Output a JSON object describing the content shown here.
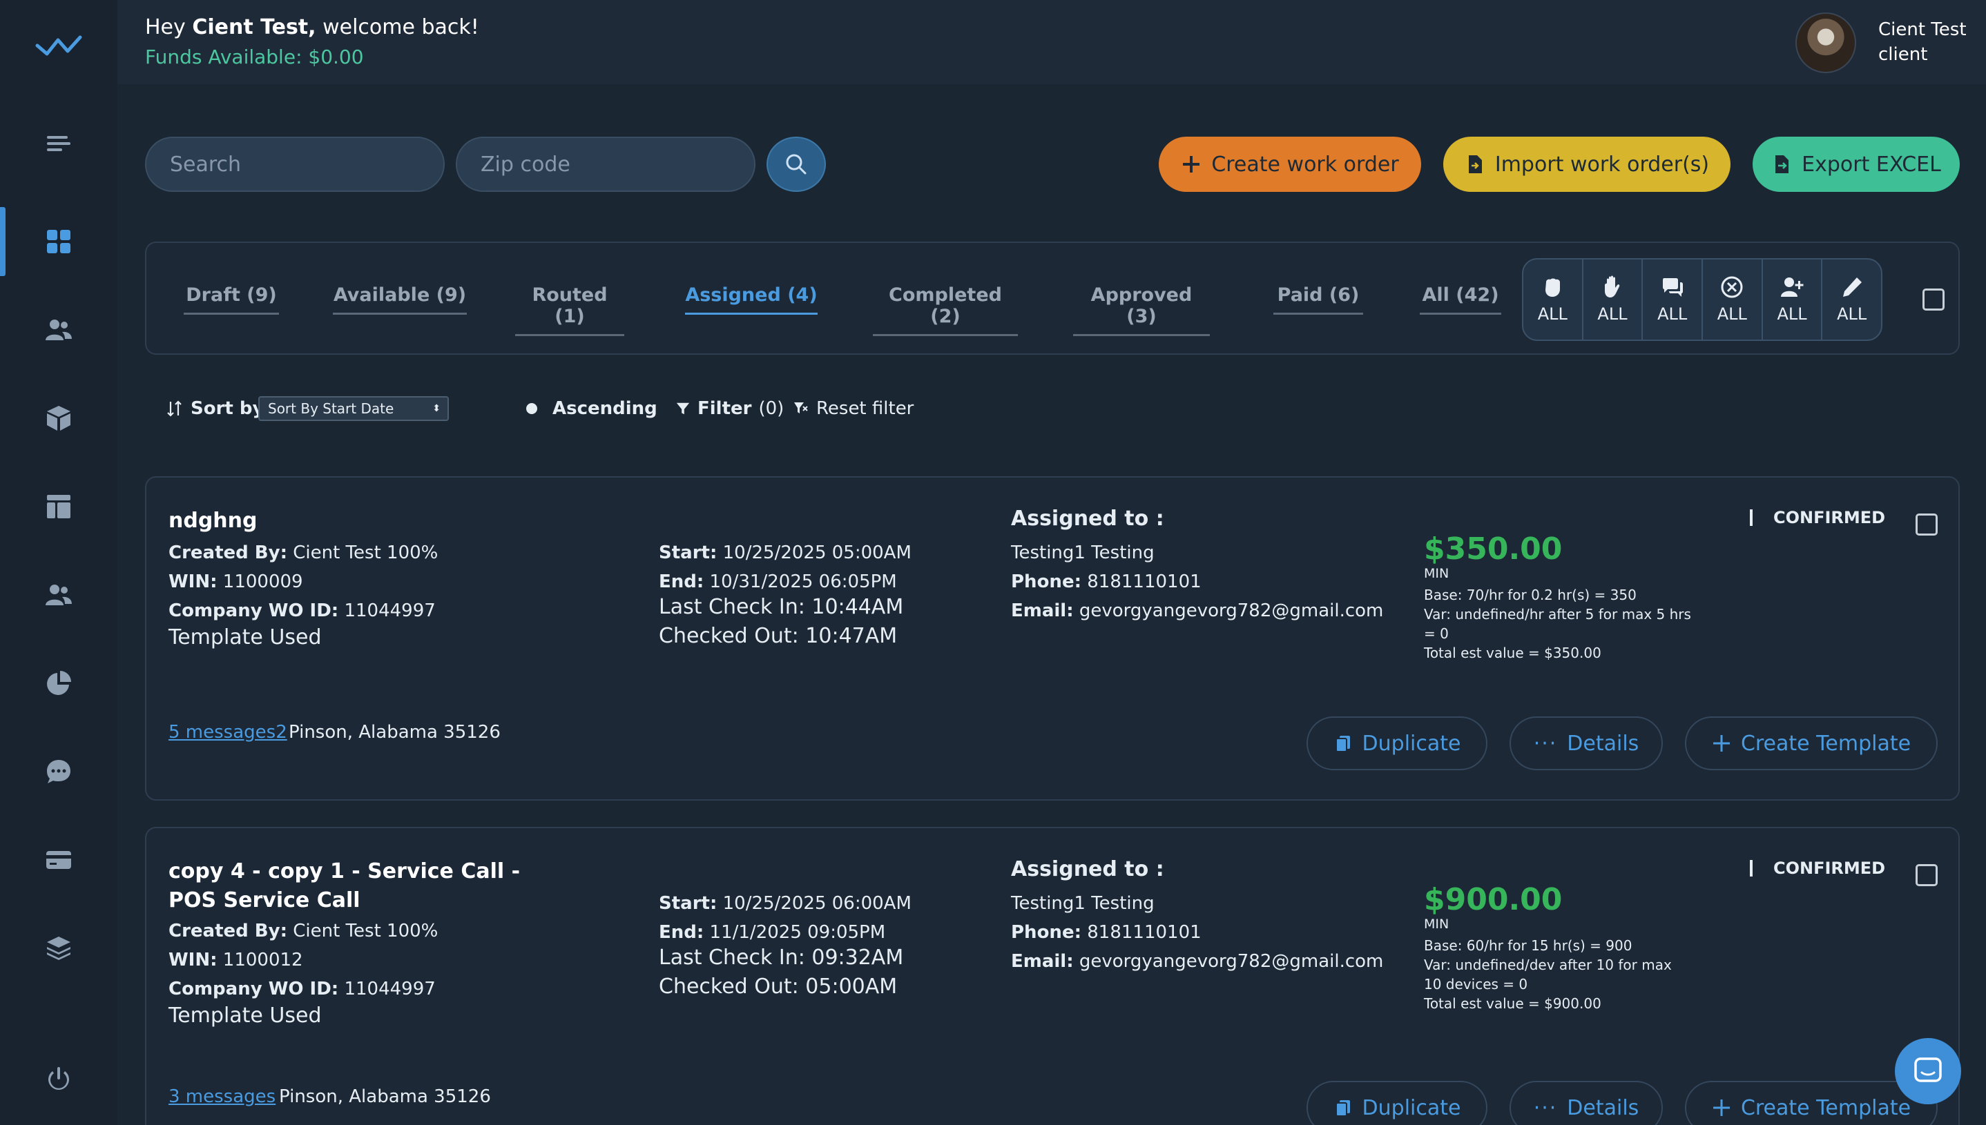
{
  "header": {
    "greeting_prefix": "Hey",
    "user_name_bold": "Cient Test,",
    "greeting_suffix": "welcome back!",
    "funds": "Funds Available: $0.00",
    "profile_name": "Cient Test",
    "profile_role": "client"
  },
  "sidebar": {
    "items": [
      "logo-icon",
      "menu-toggle-icon",
      "dashboard-icon",
      "users-icon",
      "box-icon",
      "layout-icon",
      "team-icon",
      "pie-chart-icon",
      "chat-icon",
      "card-icon",
      "layers-icon",
      "power-icon"
    ]
  },
  "search": {
    "search_placeholder": "Search",
    "zip_placeholder": "Zip code"
  },
  "actions": {
    "create": "Create work order",
    "import": "Import work order(s)",
    "export": "Export EXCEL",
    "colors": {
      "create": "#e07b2a",
      "import": "#d7b62e",
      "export": "#3fbf96"
    }
  },
  "tabs": [
    "Draft (9)",
    "Available (9)",
    "Routed (1)",
    "Assigned (4)",
    "Completed (2)",
    "Approved (3)",
    "Paid (6)",
    "All (42)"
  ],
  "active_tab": "Assigned (4)",
  "filter_group": {
    "labels": [
      "ALL",
      "ALL",
      "ALL",
      "ALL",
      "ALL",
      "ALL"
    ],
    "icons": [
      "hand-fist-icon",
      "hand-raised-icon",
      "comments-icon",
      "cancel-circle-icon",
      "user-plus-icon",
      "pencil-icon"
    ]
  },
  "sort": {
    "label": "Sort by:",
    "selected": "Sort By Start Date",
    "order": "Ascending",
    "filter": "Filter",
    "filter_count": "(0)",
    "reset": "Reset filter"
  },
  "cards": [
    {
      "title": "ndghng",
      "created_by_label": "Created By:",
      "created_by": "Cient Test 100%",
      "win_label": "WIN:",
      "win": "1100009",
      "company_label": "Company WO ID:",
      "company_wo": "11044997",
      "template": "Template Used",
      "start_label": "Start:",
      "start": "10/25/2025 05:00AM",
      "end_label": "End:",
      "end": "10/31/2025 06:05PM",
      "check_in": "Last Check In: 10:44AM",
      "check_out": "Checked Out: 10:47AM",
      "assigned_label": "Assigned to :",
      "assignee": "Testing1 Testing",
      "phone_label": "Phone:",
      "phone": "8181110101",
      "email_label": "Email:",
      "email": "gevorgyangevorg782@gmail.com",
      "price": "$350.00",
      "price_unit": "MIN",
      "calc_base": "Base: 70/hr for 0.2 hr(s) = 350",
      "calc_var": "Var: undefined/hr after 5 for max 5 hrs = 0",
      "calc_total": "Total est value = $350.00",
      "status": "CONFIRMED",
      "messages": "5 messages2",
      "location": "Pinson, Alabama 35126",
      "btn_duplicate": "Duplicate",
      "btn_details": "Details",
      "btn_template": "Create Template"
    },
    {
      "title": "copy 4 - copy 1 - Service Call - POS Service Call",
      "created_by_label": "Created By:",
      "created_by": "Cient Test 100%",
      "win_label": "WIN:",
      "win": "1100012",
      "company_label": "Company WO ID:",
      "company_wo": "11044997",
      "template": "Template Used",
      "start_label": "Start:",
      "start": "10/25/2025 06:00AM",
      "end_label": "End:",
      "end": "11/1/2025 09:05PM",
      "check_in": "Last Check In: 09:32AM",
      "check_out": "Checked Out: 05:00AM",
      "assigned_label": "Assigned to :",
      "assignee": "Testing1 Testing",
      "phone_label": "Phone:",
      "phone": "8181110101",
      "email_label": "Email:",
      "email": "gevorgyangevorg782@gmail.com",
      "price": "$900.00",
      "price_unit": "MIN",
      "calc_base": "Base: 60/hr for 15 hr(s) = 900",
      "calc_var": "Var: undefined/dev after 10 for max 10 devices = 0",
      "calc_total": "Total est value = $900.00",
      "status": "CONFIRMED",
      "messages": "3 messages",
      "location": "Pinson, Alabama 35126",
      "btn_duplicate": "Duplicate",
      "btn_details": "Details",
      "btn_template": "Create Template"
    }
  ]
}
